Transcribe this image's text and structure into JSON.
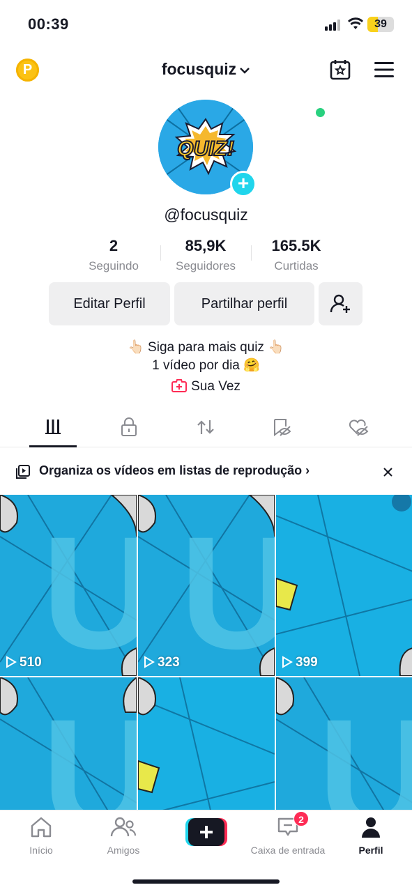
{
  "status": {
    "time": "00:39",
    "battery": "39",
    "battery_level": 0.39
  },
  "header": {
    "username": "focusquiz"
  },
  "profile": {
    "avatar_text": "QUIZ!",
    "handle": "@focusquiz",
    "stats": [
      {
        "value": "2",
        "label": "Seguindo"
      },
      {
        "value": "85,9K",
        "label": "Seguidores"
      },
      {
        "value": "165.5K",
        "label": "Curtidas"
      }
    ],
    "edit_label": "Editar Perfil",
    "share_label": "Partilhar perfil",
    "bio_line1": "👆🏻 Siga para mais quiz 👆🏻",
    "bio_line2": "1 vídeo por dia 🤗",
    "link_label": "Sua Vez"
  },
  "banner": {
    "text": "Organiza os vídeos em listas de reprodução ›"
  },
  "videos": [
    {
      "views": "510"
    },
    {
      "views": "323"
    },
    {
      "views": "399"
    },
    {
      "views": ""
    },
    {
      "views": ""
    },
    {
      "views": ""
    }
  ],
  "nav": {
    "home": "Início",
    "friends": "Amigos",
    "inbox": "Caixa de entrada",
    "inbox_badge": "2",
    "profile": "Perfil"
  },
  "colors": {
    "accent": "#fe2c55",
    "cyan": "#20d5ec",
    "text": "#161823",
    "muted": "#8a8b91"
  }
}
